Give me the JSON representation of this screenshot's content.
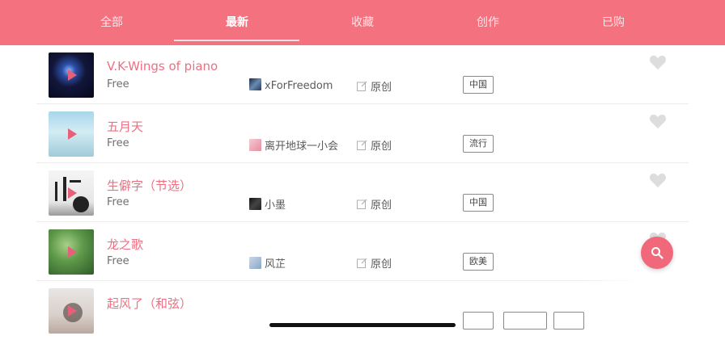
{
  "tabs": [
    "全部",
    "最新",
    "收藏",
    "创作",
    "已购"
  ],
  "active_tab": "最新",
  "songs": [
    {
      "title": "V.K-Wings of piano",
      "price": "Free",
      "author": "xForFreedom",
      "source": "原创",
      "tags": [
        "中国"
      ]
    },
    {
      "title": "五月天",
      "price": "Free",
      "author": "离开地球一小会",
      "source": "原创",
      "tags": [
        "流行"
      ]
    },
    {
      "title": "生僻字（节选）",
      "price": "Free",
      "author": "小墨",
      "source": "原创",
      "tags": [
        "中国"
      ]
    },
    {
      "title": "龙之歌",
      "price": "Free",
      "author": "风芷",
      "source": "原创",
      "tags": [
        "欧美"
      ]
    },
    {
      "title": "起风了（和弦）",
      "price": "",
      "author": "",
      "source": "",
      "tags": []
    }
  ],
  "icons": {
    "heart": "heart-icon",
    "search": "search-icon",
    "edit": "edit-icon"
  },
  "colors": {
    "accent": "#f4727f",
    "title": "#ed6f82",
    "fab": "#f0687a"
  }
}
